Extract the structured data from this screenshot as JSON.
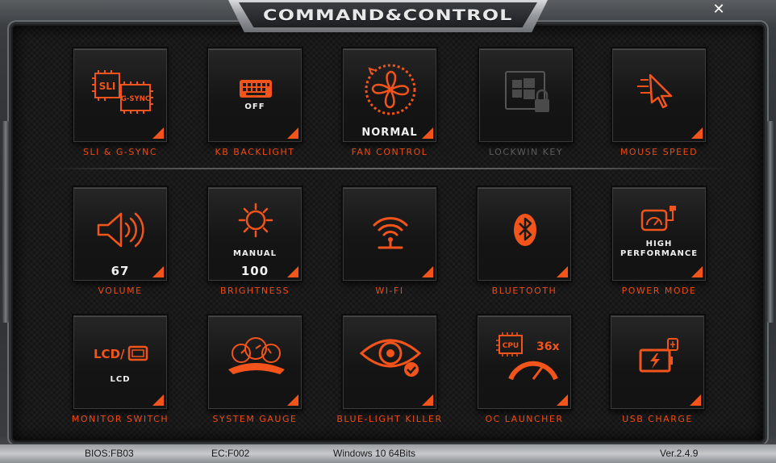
{
  "window": {
    "title": "COMMAND&CONTROL",
    "close_label": "✕"
  },
  "accent_color": "#f2541b",
  "tiles": [
    {
      "id": "sli-gsync",
      "label": "SLI & G-SYNC",
      "status": "",
      "icon": "sli-gsync-chip-icon",
      "enabled": true,
      "chip1": "SLI",
      "chip2": "G-SYNC"
    },
    {
      "id": "kb-backlight",
      "label": "KB BACKLIGHT",
      "status": "OFF",
      "icon": "keyboard-icon",
      "enabled": true
    },
    {
      "id": "fan-control",
      "label": "FAN CONTROL",
      "status": "NORMAL",
      "icon": "fan-icon",
      "enabled": true
    },
    {
      "id": "lockwin-key",
      "label": "LOCKWIN KEY",
      "status": "",
      "icon": "windows-lock-icon",
      "enabled": false
    },
    {
      "id": "mouse-speed",
      "label": "MOUSE SPEED",
      "status": "",
      "icon": "cursor-speed-icon",
      "enabled": true
    },
    {
      "id": "volume",
      "label": "VOLUME",
      "status": "67",
      "icon": "speaker-icon",
      "enabled": true
    },
    {
      "id": "brightness",
      "label": "BRIGHTNESS",
      "status_mode": "MANUAL",
      "status": "100",
      "icon": "sun-icon",
      "enabled": true
    },
    {
      "id": "wifi",
      "label": "WI-FI",
      "status": "",
      "icon": "wifi-icon",
      "enabled": true
    },
    {
      "id": "bluetooth",
      "label": "BLUETOOTH",
      "status": "",
      "icon": "bluetooth-icon",
      "enabled": true
    },
    {
      "id": "power-mode",
      "label": "POWER MODE",
      "status_line1": "HIGH",
      "status_line2": "PERFORMANCE",
      "icon": "power-gauge-icon",
      "enabled": true
    },
    {
      "id": "monitor-switch",
      "label": "MONITOR SWITCH",
      "status": "LCD",
      "icon_text": "LCD/",
      "icon": "monitor-switch-icon",
      "enabled": true
    },
    {
      "id": "system-gauge",
      "label": "SYSTEM GAUGE",
      "status": "",
      "icon": "gauges-icon",
      "enabled": true
    },
    {
      "id": "blue-light-killer",
      "label": "BLUE-LIGHT KILLER",
      "status": "",
      "icon": "eye-check-icon",
      "enabled": true
    },
    {
      "id": "oc-launcher",
      "label": "OC LAUNCHER",
      "status": "",
      "icon": "cpu-speedometer-icon",
      "enabled": true,
      "chip_text": "CPU",
      "multiplier": "36x"
    },
    {
      "id": "usb-charge",
      "label": "USB CHARGE",
      "status": "",
      "icon": "usb-battery-icon",
      "enabled": true
    }
  ],
  "status_bar": {
    "bios": "BIOS:FB03",
    "ec": "EC:F002",
    "os": "Windows 10 64Bits",
    "version": "Ver.2.4.9"
  }
}
